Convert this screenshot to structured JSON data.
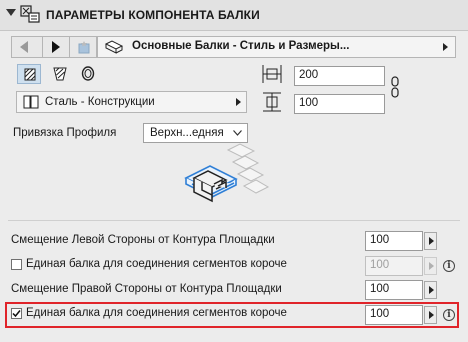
{
  "header": {
    "title": "ПАРАМЕТРЫ КОМПОНЕНТА БАЛКИ"
  },
  "component_selector": {
    "label": "Основные Балки - Стиль и Размеры..."
  },
  "material": {
    "label": "Сталь - Конструкции"
  },
  "dimensions": {
    "width_value": "200",
    "height_value": "100"
  },
  "profile_anchor": {
    "label": "Привязка Профиля",
    "selected": "Верхн...едняя"
  },
  "offsets": {
    "left_label": "Смещение Левой Стороны от Контура Площадки",
    "left_value": "100",
    "left_single_beam_label": "Единая балка для соединения сегментов короче",
    "left_single_beam_value": "100",
    "left_single_beam_checked": false,
    "right_label": "Смещение Правой Стороны от Контура Площадки",
    "right_value": "100",
    "right_single_beam_label": "Единая балка для соединения сегментов короче",
    "right_single_beam_value": "100",
    "right_single_beam_checked": true
  },
  "colors": {
    "highlight": "#e0242a",
    "preview_blue": "#2f7fd6",
    "panel_bg": "#ececec"
  }
}
